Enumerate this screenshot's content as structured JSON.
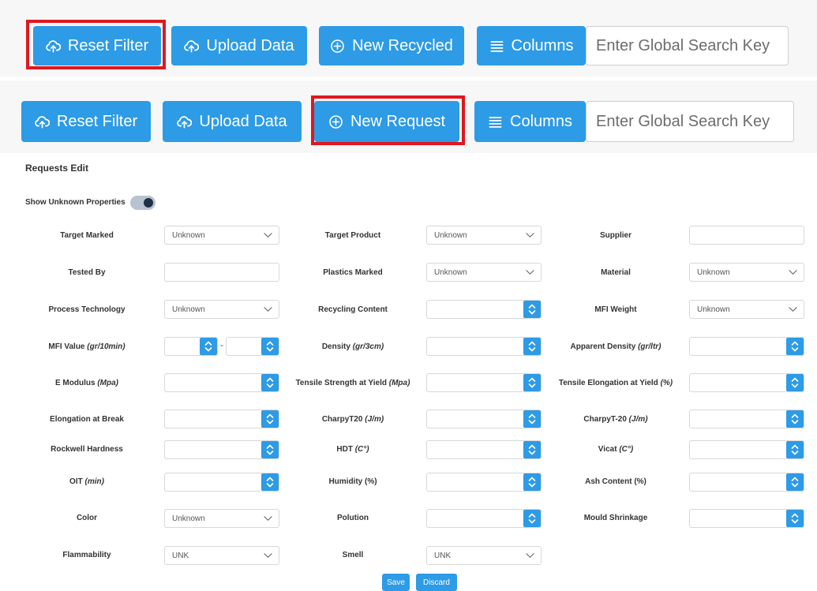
{
  "toolbar1": {
    "reset_filter": "Reset Filter",
    "upload_data": "Upload Data",
    "new_recycled": "New Recycled",
    "columns": "Columns",
    "search_placeholder": "Enter Global Search Key"
  },
  "toolbar2": {
    "reset_filter": "Reset Filter",
    "upload_data": "Upload Data",
    "new_request": "New Request",
    "columns": "Columns",
    "search_placeholder": "Enter Global Search Key"
  },
  "form": {
    "title": "Requests Edit",
    "toggle_label": "Show Unknown Properties",
    "show_unknown": true,
    "labels": {
      "target_marked": "Target Marked",
      "target_product": "Target Product",
      "supplier": "Supplier",
      "tested_by": "Tested By",
      "plastics_marked": "Plastics Marked",
      "material": "Material",
      "process_technology": "Process Technology",
      "recycling_content": "Recycling Content",
      "mfi_weight": "MFI Weight",
      "mfi_value": "MFI Value",
      "mfi_value_unit": "(gr/10min)",
      "density": "Density",
      "density_unit": "(gr/3cm)",
      "apparent_density": "Apparent Density",
      "apparent_density_unit": "(gr/ltr)",
      "e_modulus": "E Modulus",
      "e_modulus_unit": "(Mpa)",
      "tensile_strength": "Tensile Strength at Yield",
      "tensile_strength_unit": "(Mpa)",
      "tensile_elongation": "Tensile Elongation at Yield",
      "tensile_elongation_unit": "(%)",
      "elongation_break": "Elongation at Break",
      "charpy_t20": "CharpyT20",
      "charpy_t20_unit": "(J/m)",
      "charpy_tm20": "CharpyT-20",
      "charpy_tm20_unit": "(J/m)",
      "rockwell": "Rockwell Hardness",
      "hdt": "HDT",
      "hdt_unit": "(C°)",
      "vicat": "Vicat",
      "vicat_unit": "(C°)",
      "oit": "OIT",
      "oit_unit": "(min)",
      "humidity": "Humidity (%)",
      "ash": "Ash Content (%)",
      "color": "Color",
      "polution": "Polution",
      "mould_shrinkage": "Mould Shrinkage",
      "flammability": "Flammability",
      "smell": "Smell"
    },
    "values": {
      "target_marked": "Unknown",
      "target_product": "Unknown",
      "plastics_marked": "Unknown",
      "material": "Unknown",
      "process_technology": "Unknown",
      "mfi_weight": "Unknown",
      "color": "Unknown",
      "flammability": "UNK",
      "smell": "UNK"
    },
    "range_separator": "-",
    "save": "Save",
    "discard": "Discard"
  },
  "colors": {
    "primary": "#2d9be6",
    "highlight": "#e0171f"
  }
}
